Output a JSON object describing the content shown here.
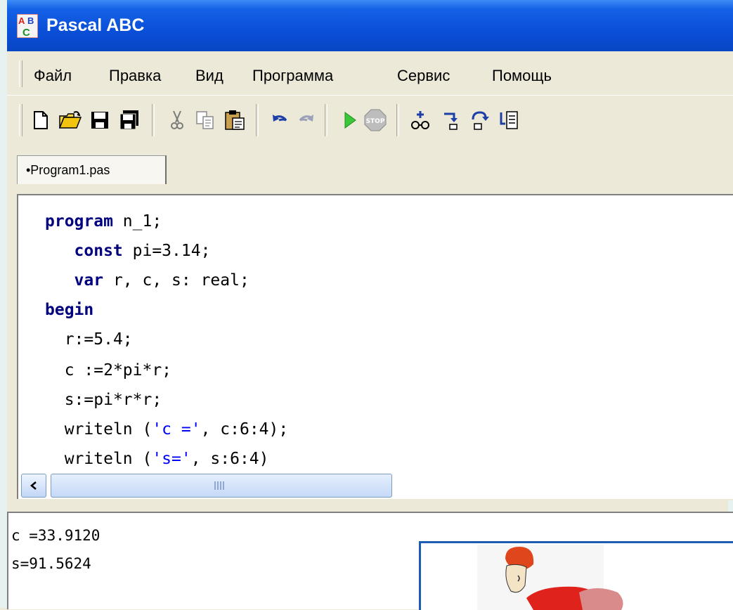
{
  "window": {
    "title": "Pascal ABC"
  },
  "menu": {
    "items": [
      "Файл",
      "Правка",
      "Вид",
      "Программа",
      "Сервис",
      "Помощь"
    ]
  },
  "toolbar": {
    "buttons": [
      "new-file-icon",
      "open-folder-icon",
      "save-icon",
      "save-all-icon",
      "cut-icon",
      "copy-icon",
      "paste-icon",
      "undo-icon",
      "redo-icon",
      "run-icon",
      "stop-icon",
      "add-watch-icon",
      "step-into-icon",
      "step-over-icon",
      "evaluate-icon"
    ]
  },
  "tabs": [
    {
      "label": "•Program1.pas"
    }
  ],
  "editor": {
    "lines": [
      {
        "indent": "",
        "kw": "program",
        "rest": " n_1;"
      },
      {
        "indent": "   ",
        "kw": "const",
        "rest": " pi=3.14;"
      },
      {
        "indent": "   ",
        "kw": "var",
        "rest": " r, c, s: real;"
      },
      {
        "indent": "",
        "kw": "begin",
        "rest": ""
      },
      {
        "indent": "  ",
        "kw": "",
        "rest": "r:=5.4;"
      },
      {
        "indent": "  ",
        "kw": "",
        "rest": "c :=2*pi*r;"
      },
      {
        "indent": "  ",
        "kw": "",
        "rest": "s:=pi*r*r;"
      },
      {
        "indent": "  ",
        "kw": "",
        "rest": "writeln (",
        "str": "'c ='",
        "tail": ", c:6:4);"
      },
      {
        "indent": "  ",
        "kw": "",
        "rest": "writeln (",
        "str": "'s='",
        "tail": ", s:6:4)"
      }
    ]
  },
  "output": {
    "lines": [
      "c =33.9120",
      "s=91.5624"
    ]
  },
  "colors": {
    "titlebar": "#0a4fd8",
    "keyword": "#00007f",
    "string": "#0000ff",
    "picture_border": "#1e5cb3"
  }
}
